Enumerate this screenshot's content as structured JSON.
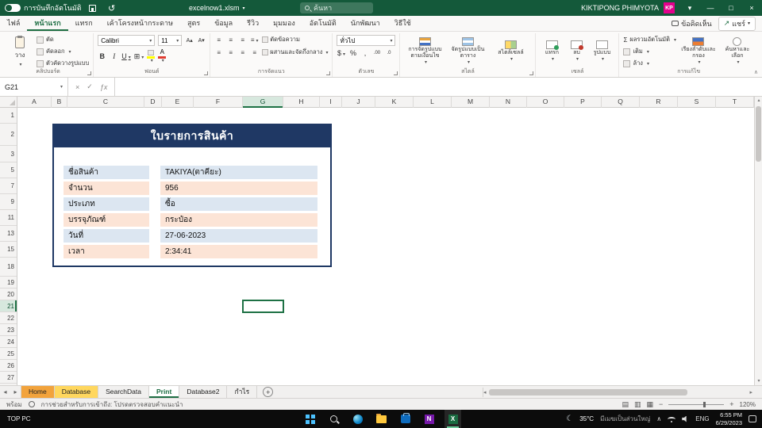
{
  "icons": {
    "caret": "▾",
    "undo": "↺",
    "minimize": "—",
    "maximize": "□",
    "close": "×",
    "cancel": "×",
    "check": "✓",
    "fx": "ƒx",
    "sigma": "Σ",
    "align": "≡",
    "borders": "⊞",
    "moon": "☾",
    "chevron_up": "∧",
    "left": "◂",
    "right": "▸",
    "up": "▴",
    "down": "▾",
    "view_normal": "▤",
    "view_layout": "▥",
    "view_break": "▦",
    "plus": "+",
    "minus": "−",
    "dollar": "$",
    "percent": "%",
    "comma": ",",
    "bold": "B",
    "italic": "I",
    "underline": "U",
    "font_grow": "A▴",
    "font_shrink": "A▾",
    "dec_more": ".00",
    "dec_less": ".0",
    "share_arrow": "↗"
  },
  "title_bar": {
    "autosave_label": "การบันทึกอัตโนมัติ",
    "file_name": "excelnow1.xlsm",
    "search_placeholder": "ค้นหา",
    "user_name": "KIKTIPONG PHIMYOTA",
    "user_initials": "KP"
  },
  "ribbon": {
    "tabs": [
      "ไฟล์",
      "หน้าแรก",
      "แทรก",
      "เค้าโครงหน้ากระดาษ",
      "สูตร",
      "ข้อมูล",
      "รีวิว",
      "มุมมอง",
      "อัตโนมัติ",
      "นักพัฒนา",
      "วิธีใช้"
    ],
    "active_tab": "หน้าแรก",
    "comments_label": "ข้อคิดเห็น",
    "share_label": "แชร์",
    "font_name": "Calibri",
    "font_size": "11",
    "number_format": "ทั่วไป",
    "clipboard": {
      "paste": "วาง",
      "cut": "ตัด",
      "copy": "คัดลอก",
      "format_painter": "ตัวคัดวางรูปแบบ"
    },
    "alignment": {
      "wrap_text": "ตัดข้อความ",
      "merge_center": "ผสานและจัดกึ่งกลาง"
    },
    "styles": {
      "conditional": "การจัดรูปแบบตามเงื่อนไข",
      "format_table": "จัดรูปแบบเป็นตาราง",
      "cell_styles": "สไตล์เซลล์"
    },
    "cells": {
      "insert": "แทรก",
      "delete": "ลบ",
      "format": "รูปแบบ"
    },
    "editing": {
      "autosum": "ผลรวมอัตโนมัติ",
      "fill": "เติม",
      "clear": "ล้าง",
      "sort_filter": "เรียงลำดับและกรอง",
      "find_select": "ค้นหาและเลือก"
    },
    "group_labels": [
      "คลิปบอร์ด",
      "ฟอนต์",
      "การจัดแนว",
      "ตัวเลข",
      "สไตล์",
      "เซลล์",
      "การแก้ไข"
    ]
  },
  "formula_bar": {
    "name_box": "G21",
    "value": ""
  },
  "grid": {
    "columns": [
      "A",
      "B",
      "C",
      "D",
      "E",
      "F",
      "G",
      "H",
      "I",
      "J",
      "K",
      "L",
      "M",
      "N",
      "O",
      "P",
      "Q",
      "R",
      "S",
      "T"
    ],
    "rows": [
      1,
      2,
      3,
      5,
      7,
      9,
      11,
      13,
      15,
      18,
      19,
      20,
      21,
      22,
      23,
      24,
      25,
      26,
      27
    ],
    "selected_cell": "G21"
  },
  "form": {
    "title": "ใบรายการสินค้า",
    "rows": [
      {
        "label": "ชื่อสินค้า",
        "value": "TAKIYA(ตาคียะ)"
      },
      {
        "label": "จำนวน",
        "value": "956"
      },
      {
        "label": "ประเภท",
        "value": "ซื้อ"
      },
      {
        "label": "บรรจุภัณฑ์",
        "value": "กระป๋อง"
      },
      {
        "label": "วันที่",
        "value": "27-06-2023"
      },
      {
        "label": "เวลา",
        "value": "2:34:41"
      }
    ]
  },
  "sheet_tabs": [
    {
      "label": "Home",
      "color": "#F2A33C"
    },
    {
      "label": "Database",
      "color": "#FFD75E"
    },
    {
      "label": "SearchData"
    },
    {
      "label": "Print",
      "active": true
    },
    {
      "label": "Database2"
    },
    {
      "label": "กำไร"
    }
  ],
  "status_bar": {
    "mode": "พร้อม",
    "accessibility": "การช่วยสำหรับการเข้าถึง: โปรดตรวจสอบคำแนะนำ",
    "zoom": "120%"
  },
  "taskbar": {
    "pc_label": "TOP PC",
    "apps": [
      {
        "name": "start"
      },
      {
        "name": "search"
      },
      {
        "name": "edge"
      },
      {
        "name": "explorer"
      },
      {
        "name": "store"
      },
      {
        "name": "onenote",
        "glyph": "N"
      },
      {
        "name": "excel",
        "glyph": "X",
        "active": true
      }
    ],
    "weather": {
      "temp": "35°C",
      "desc": "มีเมฆเป็นส่วนใหญ่"
    },
    "language": "ENG",
    "time": "6:55 PM",
    "date": "6/29/2023"
  }
}
